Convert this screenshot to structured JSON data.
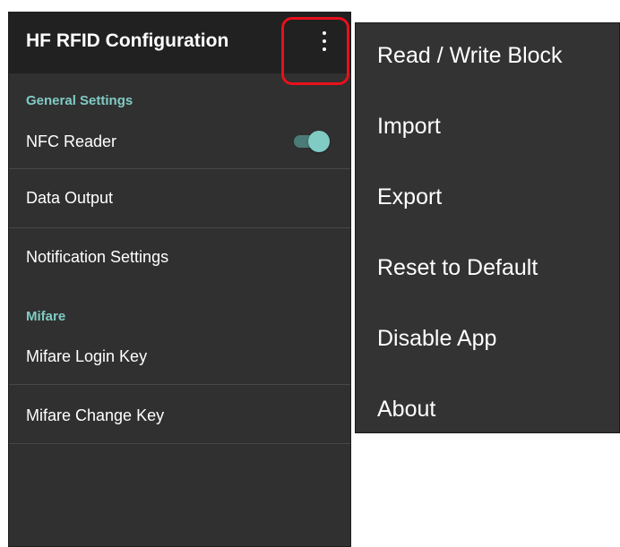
{
  "appbar": {
    "title": "HF RFID Configuration",
    "overflow_icon": "more-vert-icon"
  },
  "sections": {
    "general": "General Settings",
    "mifare": "Mifare"
  },
  "items": {
    "nfc_reader": {
      "label": "NFC Reader",
      "toggle_on": true
    },
    "data_output": "Data Output",
    "notification_settings": "Notification Settings",
    "mifare_login_key": "Mifare Login Key",
    "mifare_change_key": "Mifare Change Key"
  },
  "menu": {
    "items": [
      "Read / Write Block",
      "Import",
      "Export",
      "Reset to Default",
      "Disable App",
      "About"
    ]
  },
  "colors": {
    "accent": "#80cbc4",
    "highlight": "#e8101c",
    "background": "#303030",
    "appbar": "#212121"
  }
}
